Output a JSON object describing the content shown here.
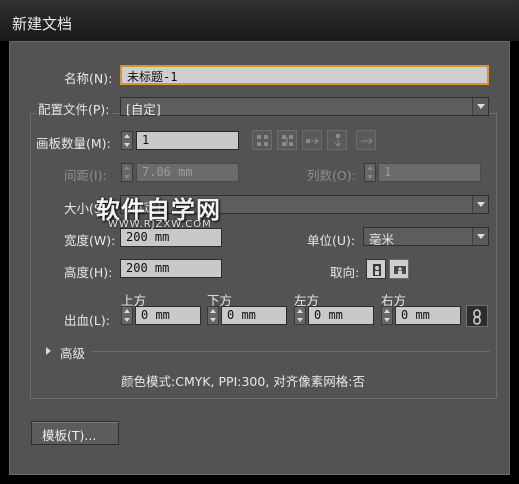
{
  "window": {
    "title": "新建文档"
  },
  "name": {
    "label": "名称(N):",
    "value": "未标题-1"
  },
  "profile": {
    "label": "配置文件(P):",
    "value": "[自定]"
  },
  "artboards": {
    "count_label": "画板数量(M):",
    "count_value": "1",
    "spacing_label": "间距(I):",
    "spacing_value": "7.06 mm",
    "columns_label": "列数(O):",
    "columns_value": "1"
  },
  "size": {
    "label": "大小(S):",
    "value": "[自定]"
  },
  "width": {
    "label": "宽度(W):",
    "value": "200 mm"
  },
  "height": {
    "label": "高度(H):",
    "value": "200 mm"
  },
  "units": {
    "label": "单位(U):",
    "value": "毫米"
  },
  "orientation": {
    "label": "取向:"
  },
  "bleed": {
    "label": "出血(L):",
    "top_label": "上方",
    "top_value": "0 mm",
    "bottom_label": "下方",
    "bottom_value": "0 mm",
    "left_label": "左方",
    "left_value": "0 mm",
    "right_label": "右方",
    "right_value": "0 mm"
  },
  "advanced": {
    "label": "高级"
  },
  "info": {
    "text": "颜色模式:CMYK, PPI:300, 对齐像素网格:否"
  },
  "templates_button": {
    "label": "模板(T)..."
  },
  "watermark": {
    "title": "软件自学网",
    "url": "WWW.RJZXW.COM"
  },
  "colors": {
    "accent": "#d99431",
    "panel": "#535353",
    "title_bar": "#202223"
  }
}
